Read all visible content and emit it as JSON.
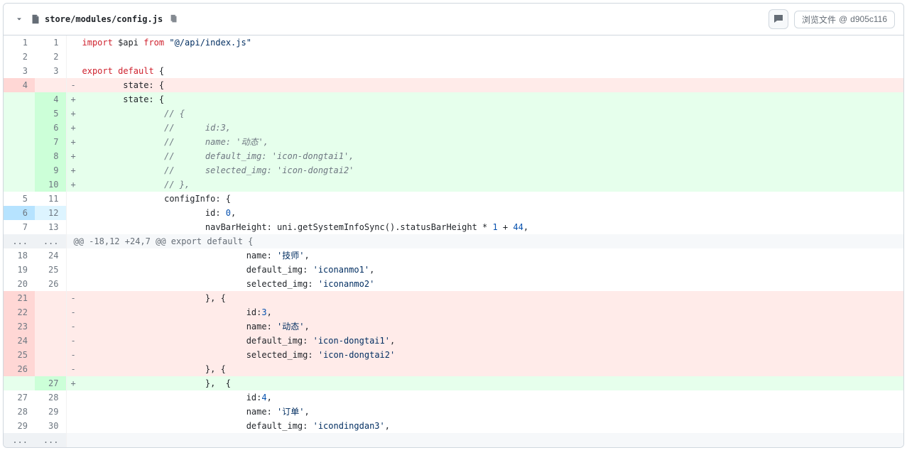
{
  "header": {
    "file_path": "store/modules/config.js",
    "browse_label": "浏览文件",
    "browse_sep": "@",
    "commit_sha": "d905c116"
  },
  "diff": {
    "hunk1_header": "@@ -18,12 +24,7 @@ export default {",
    "ellipsis": "...",
    "rows": [
      {
        "type": "context",
        "old": "1",
        "new": "1",
        "sign": "",
        "tokens": [
          {
            "c": "tok-kw",
            "t": "import"
          },
          {
            "t": " $api "
          },
          {
            "c": "tok-kw",
            "t": "from"
          },
          {
            "t": " "
          },
          {
            "c": "tok-str",
            "t": "\"@/api/index.js\""
          }
        ]
      },
      {
        "type": "context",
        "old": "2",
        "new": "2",
        "sign": "",
        "tokens": []
      },
      {
        "type": "context",
        "old": "3",
        "new": "3",
        "sign": "",
        "tokens": [
          {
            "c": "tok-kw",
            "t": "export"
          },
          {
            "t": " "
          },
          {
            "c": "tok-kw",
            "t": "default"
          },
          {
            "t": " {"
          }
        ]
      },
      {
        "type": "deletion",
        "old": "4",
        "new": "",
        "sign": "-",
        "tokens": [
          {
            "t": "        state: {"
          }
        ]
      },
      {
        "type": "addition",
        "old": "",
        "new": "4",
        "sign": "+",
        "tokens": [
          {
            "t": "        state: {"
          }
        ]
      },
      {
        "type": "addition",
        "old": "",
        "new": "5",
        "sign": "+",
        "tokens": [
          {
            "t": "                "
          },
          {
            "c": "tok-cmt",
            "t": "// {"
          }
        ]
      },
      {
        "type": "addition",
        "old": "",
        "new": "6",
        "sign": "+",
        "tokens": [
          {
            "t": "                "
          },
          {
            "c": "tok-cmt",
            "t": "//      id:3,"
          }
        ]
      },
      {
        "type": "addition",
        "old": "",
        "new": "7",
        "sign": "+",
        "tokens": [
          {
            "t": "                "
          },
          {
            "c": "tok-cmt",
            "t": "//      name: '动态',"
          }
        ]
      },
      {
        "type": "addition",
        "old": "",
        "new": "8",
        "sign": "+",
        "tokens": [
          {
            "t": "                "
          },
          {
            "c": "tok-cmt",
            "t": "//      default_img: 'icon-dongtai1',"
          }
        ]
      },
      {
        "type": "addition",
        "old": "",
        "new": "9",
        "sign": "+",
        "tokens": [
          {
            "t": "                "
          },
          {
            "c": "tok-cmt",
            "t": "//      selected_img: 'icon-dongtai2'"
          }
        ]
      },
      {
        "type": "addition",
        "old": "",
        "new": "10",
        "sign": "+",
        "tokens": [
          {
            "t": "                "
          },
          {
            "c": "tok-cmt",
            "t": "// },"
          }
        ]
      },
      {
        "type": "context",
        "old": "5",
        "new": "11",
        "sign": "",
        "tokens": [
          {
            "t": "                configInfo: {"
          }
        ]
      },
      {
        "type": "context highlight-row",
        "old": "6",
        "new": "12",
        "sign": "",
        "tokens": [
          {
            "t": "                        id: "
          },
          {
            "c": "tok-num",
            "t": "0"
          },
          {
            "t": ","
          }
        ]
      },
      {
        "type": "context",
        "old": "7",
        "new": "13",
        "sign": "",
        "tokens": [
          {
            "t": "                        navBarHeight: uni.getSystemInfoSync().statusBarHeight * "
          },
          {
            "c": "tok-num",
            "t": "1"
          },
          {
            "t": " + "
          },
          {
            "c": "tok-num",
            "t": "44"
          },
          {
            "t": ","
          }
        ]
      },
      {
        "type": "hunk",
        "old": "...",
        "new": "...",
        "sign": "",
        "hunk_text": "@@ -18,12 +24,7 @@ export default {"
      },
      {
        "type": "context",
        "old": "18",
        "new": "24",
        "sign": "",
        "tokens": [
          {
            "t": "                                name: "
          },
          {
            "c": "tok-str",
            "t": "'技师'"
          },
          {
            "t": ","
          }
        ]
      },
      {
        "type": "context",
        "old": "19",
        "new": "25",
        "sign": "",
        "tokens": [
          {
            "t": "                                default_img: "
          },
          {
            "c": "tok-str",
            "t": "'iconanmo1'"
          },
          {
            "t": ","
          }
        ]
      },
      {
        "type": "context",
        "old": "20",
        "new": "26",
        "sign": "",
        "tokens": [
          {
            "t": "                                selected_img: "
          },
          {
            "c": "tok-str",
            "t": "'iconanmo2'"
          }
        ]
      },
      {
        "type": "deletion",
        "old": "21",
        "new": "",
        "sign": "-",
        "tokens": [
          {
            "t": "                        }, {"
          }
        ]
      },
      {
        "type": "deletion",
        "old": "22",
        "new": "",
        "sign": "-",
        "tokens": [
          {
            "t": "                                id:"
          },
          {
            "c": "tok-num",
            "t": "3"
          },
          {
            "t": ","
          }
        ]
      },
      {
        "type": "deletion",
        "old": "23",
        "new": "",
        "sign": "-",
        "tokens": [
          {
            "t": "                                name: "
          },
          {
            "c": "tok-str",
            "t": "'动态'"
          },
          {
            "t": ","
          }
        ]
      },
      {
        "type": "deletion",
        "old": "24",
        "new": "",
        "sign": "-",
        "tokens": [
          {
            "t": "                                default_img: "
          },
          {
            "c": "tok-str",
            "t": "'icon-dongtai1'"
          },
          {
            "t": ","
          }
        ]
      },
      {
        "type": "deletion",
        "old": "25",
        "new": "",
        "sign": "-",
        "tokens": [
          {
            "t": "                                selected_img: "
          },
          {
            "c": "tok-str",
            "t": "'icon-dongtai2'"
          }
        ]
      },
      {
        "type": "deletion",
        "old": "26",
        "new": "",
        "sign": "-",
        "tokens": [
          {
            "t": "                        }, {"
          }
        ]
      },
      {
        "type": "addition",
        "old": "",
        "new": "27",
        "sign": "+",
        "tokens": [
          {
            "t": "                        },  {"
          }
        ]
      },
      {
        "type": "context",
        "old": "27",
        "new": "28",
        "sign": "",
        "tokens": [
          {
            "t": "                                id:"
          },
          {
            "c": "tok-num",
            "t": "4"
          },
          {
            "t": ","
          }
        ]
      },
      {
        "type": "context",
        "old": "28",
        "new": "29",
        "sign": "",
        "tokens": [
          {
            "t": "                                name: "
          },
          {
            "c": "tok-str",
            "t": "'订单'"
          },
          {
            "t": ","
          }
        ]
      },
      {
        "type": "context",
        "old": "29",
        "new": "30",
        "sign": "",
        "tokens": [
          {
            "t": "                                default_img: "
          },
          {
            "c": "tok-str",
            "t": "'icondingdan3'"
          },
          {
            "t": ","
          }
        ]
      },
      {
        "type": "hunk",
        "old": "...",
        "new": "...",
        "sign": "",
        "hunk_text": ""
      }
    ]
  }
}
